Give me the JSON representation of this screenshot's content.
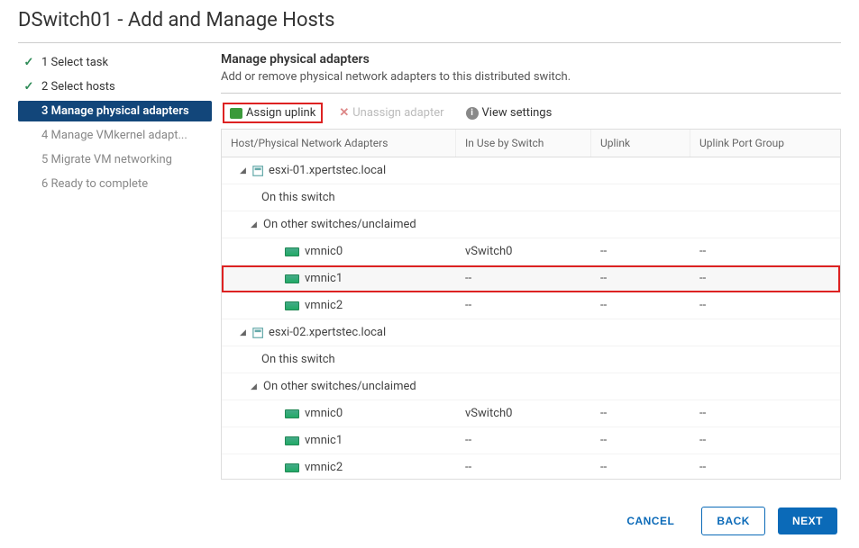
{
  "title": "DSwitch01 - Add and Manage Hosts",
  "steps": [
    {
      "label": "1 Select task",
      "state": "done"
    },
    {
      "label": "2 Select hosts",
      "state": "done"
    },
    {
      "label": "3 Manage physical adapters",
      "state": "current"
    },
    {
      "label": "4 Manage VMkernel adapt...",
      "state": "future"
    },
    {
      "label": "5 Migrate VM networking",
      "state": "future"
    },
    {
      "label": "6 Ready to complete",
      "state": "future"
    }
  ],
  "panel": {
    "title": "Manage physical adapters",
    "desc": "Add or remove physical network adapters to this distributed switch."
  },
  "toolbar": {
    "assign": "Assign uplink",
    "unassign": "Unassign adapter",
    "view": "View settings"
  },
  "columns": {
    "c1": "Host/Physical Network Adapters",
    "c2": "In Use by Switch",
    "c3": "Uplink",
    "c4": "Uplink Port Group"
  },
  "hosts": [
    {
      "name": "esxi-01.xpertstec.local",
      "on_this_switch_label": "On this switch",
      "unclaimed_label": "On other switches/unclaimed",
      "nics": [
        {
          "name": "vmnic0",
          "switch": "vSwitch0",
          "uplink": "--",
          "portgroup": "--",
          "selected": false
        },
        {
          "name": "vmnic1",
          "switch": "--",
          "uplink": "--",
          "portgroup": "--",
          "selected": true
        },
        {
          "name": "vmnic2",
          "switch": "--",
          "uplink": "--",
          "portgroup": "--",
          "selected": false
        }
      ]
    },
    {
      "name": "esxi-02.xpertstec.local",
      "on_this_switch_label": "On this switch",
      "unclaimed_label": "On other switches/unclaimed",
      "nics": [
        {
          "name": "vmnic0",
          "switch": "vSwitch0",
          "uplink": "--",
          "portgroup": "--",
          "selected": false
        },
        {
          "name": "vmnic1",
          "switch": "--",
          "uplink": "--",
          "portgroup": "--",
          "selected": false
        },
        {
          "name": "vmnic2",
          "switch": "--",
          "uplink": "--",
          "portgroup": "--",
          "selected": false
        }
      ]
    }
  ],
  "footer": {
    "cancel": "CANCEL",
    "back": "BACK",
    "next": "NEXT"
  }
}
